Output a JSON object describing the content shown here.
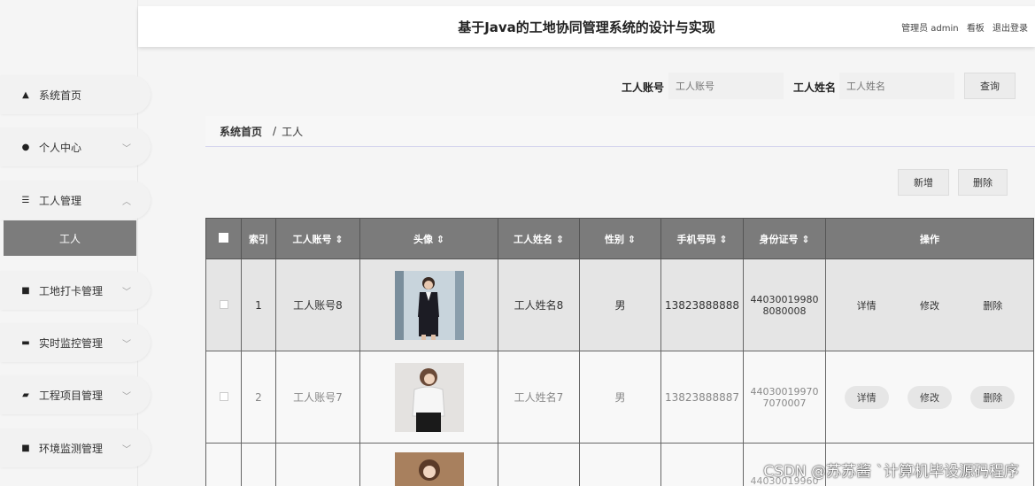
{
  "header": {
    "title": "基于Java的工地协同管理系统的设计与实现",
    "user": "管理员 admin",
    "links": [
      "看板",
      "退出登录"
    ]
  },
  "sidebar": {
    "items": [
      {
        "label": "系统首页",
        "icon": "home-icon"
      },
      {
        "label": "个人中心",
        "icon": "user-icon"
      },
      {
        "label": "工人管理",
        "icon": "list-icon"
      },
      {
        "label": "工地打卡管理",
        "icon": "grid-icon"
      },
      {
        "label": "实时监控管理",
        "icon": "monitor-icon"
      },
      {
        "label": "工程项目管理",
        "icon": "briefcase-icon"
      },
      {
        "label": "环境监测管理",
        "icon": "grid-icon"
      }
    ],
    "active_sub": "工人"
  },
  "search": {
    "account_label": "工人账号",
    "account_placeholder": "工人账号",
    "name_label": "工人姓名",
    "name_placeholder": "工人姓名",
    "query_label": "查询"
  },
  "breadcrumb": {
    "home": "系统首页",
    "sep": "/",
    "current": "工人"
  },
  "actions": {
    "add": "新增",
    "delete": "删除"
  },
  "table": {
    "headers": [
      "索引",
      "工人账号 ⇕",
      "头像 ⇕",
      "工人姓名 ⇕",
      "性别 ⇕",
      "手机号码 ⇕",
      "身份证号 ⇕",
      "操作"
    ],
    "rows": [
      {
        "index": "1",
        "account": "工人账号8",
        "name": "工人姓名8",
        "gender": "男",
        "phone": "13823888888",
        "id_number": "44030019980\n8080008"
      },
      {
        "index": "2",
        "account": "工人账号7",
        "name": "工人姓名7",
        "gender": "男",
        "phone": "13823888887",
        "id_number": "44030019970\n7070007"
      },
      {
        "index": "",
        "account": "",
        "name": "",
        "gender": "",
        "phone": "",
        "id_number": "44030019960"
      }
    ],
    "ops": [
      "详情",
      "修改",
      "删除"
    ]
  },
  "watermark": "CSDN @苏苏酱  `计算机毕设源码程序"
}
